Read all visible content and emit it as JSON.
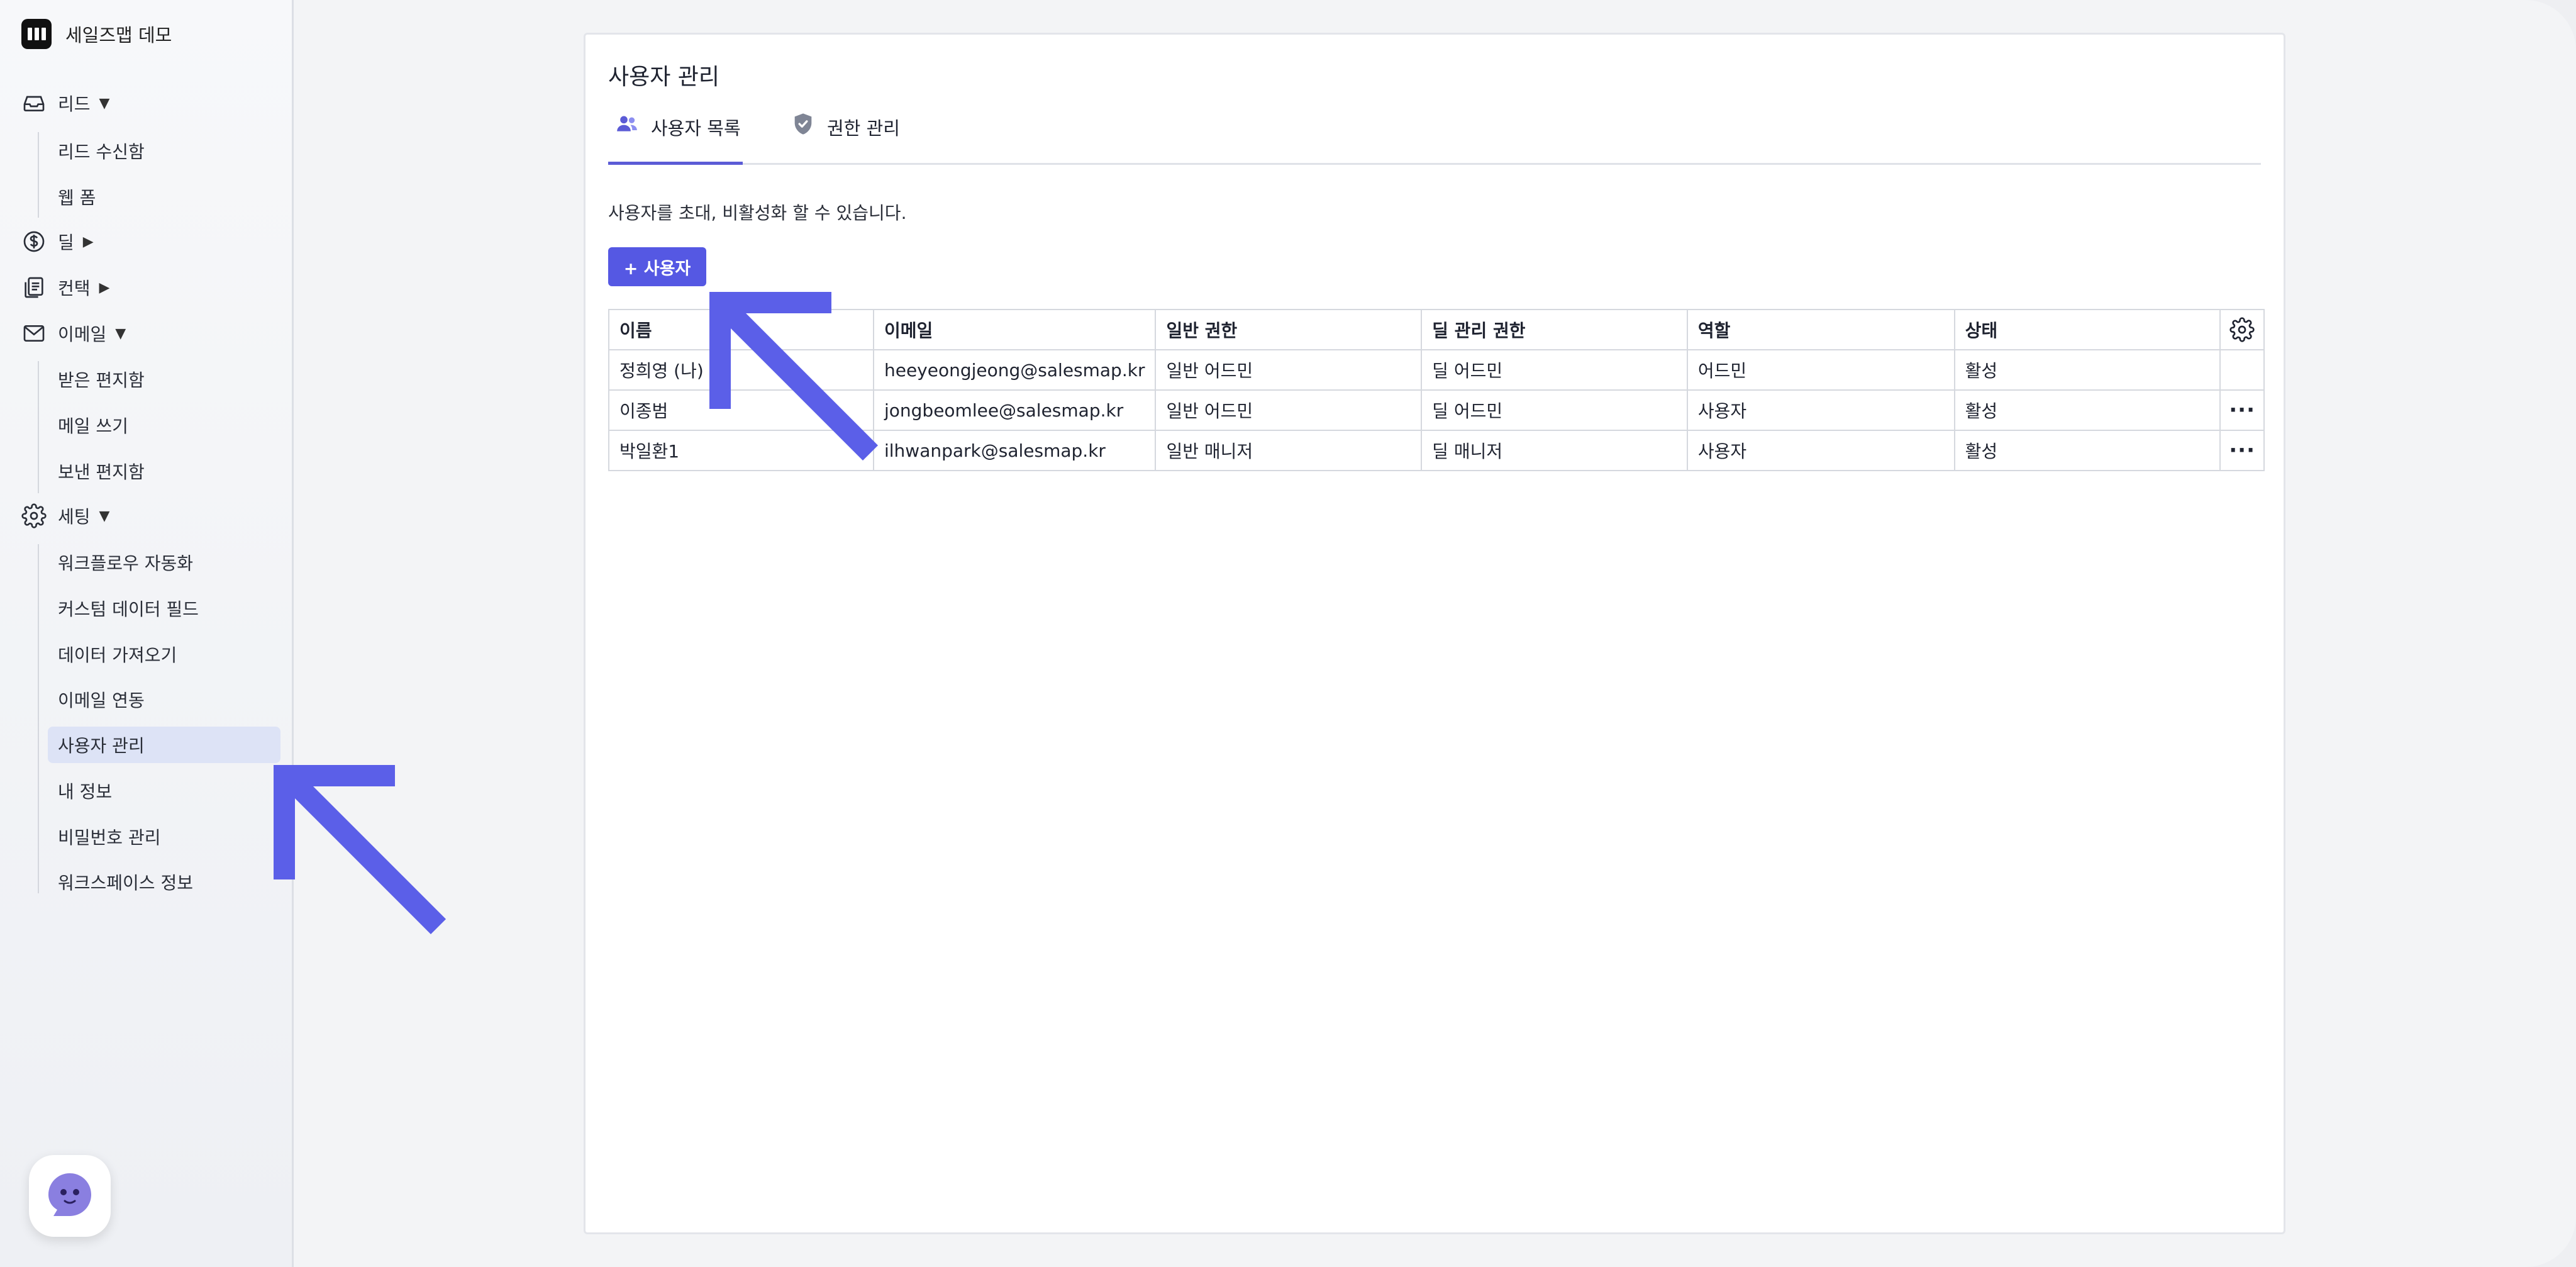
{
  "brand": {
    "name": "세일즈맵 데모"
  },
  "sidebar": {
    "groups": [
      {
        "icon": "inbox-icon",
        "label": "리드",
        "caret": "▼",
        "items": [
          "리드 수신함",
          "웹 폼"
        ]
      },
      {
        "icon": "dollar-icon",
        "label": "딜",
        "caret": "▶",
        "items": []
      },
      {
        "icon": "contacts-icon",
        "label": "컨택",
        "caret": "▶",
        "items": []
      },
      {
        "icon": "mail-icon",
        "label": "이메일",
        "caret": "▼",
        "items": [
          "받은 편지함",
          "메일 쓰기",
          "보낸 편지함"
        ]
      },
      {
        "icon": "gear-icon",
        "label": "세팅",
        "caret": "▼",
        "items": [
          "워크플로우 자동화",
          "커스텀 데이터 필드",
          "데이터 가져오기",
          "이메일 연동",
          "사용자 관리",
          "내 정보",
          "비밀번호 관리",
          "워크스페이스 정보"
        ]
      }
    ],
    "active_item": "사용자 관리"
  },
  "main": {
    "title": "사용자 관리",
    "tabs": [
      {
        "icon": "users-icon",
        "label": "사용자 목록",
        "active": true
      },
      {
        "icon": "shield-icon",
        "label": "권한 관리",
        "active": false
      }
    ],
    "description": "사용자를 초대, 비활성화 할 수 있습니다.",
    "add_button": "+ 사용자",
    "table": {
      "columns": [
        "이름",
        "이메일",
        "일반 권한",
        "딜 관리 권한",
        "역할",
        "상태"
      ],
      "rows": [
        {
          "name": "정희영 (나)",
          "email": "heeyeongjeong@salesmap.kr",
          "general": "일반 어드민",
          "deal": "딜 어드민",
          "role": "어드민",
          "status": "활성",
          "has_menu": false
        },
        {
          "name": "이종범",
          "email": "jongbeomlee@salesmap.kr",
          "general": "일반 어드민",
          "deal": "딜 어드민",
          "role": "사용자",
          "status": "활성",
          "has_menu": true
        },
        {
          "name": "박일환1",
          "email": "ilhwanpark@salesmap.kr",
          "general": "일반 매니저",
          "deal": "딜 매니저",
          "role": "사용자",
          "status": "활성",
          "has_menu": true
        }
      ],
      "menu_glyph": "···"
    }
  },
  "colors": {
    "accent": "#5558e3",
    "arrow": "#5b5fe8",
    "active_bg": "#dde3f6"
  }
}
